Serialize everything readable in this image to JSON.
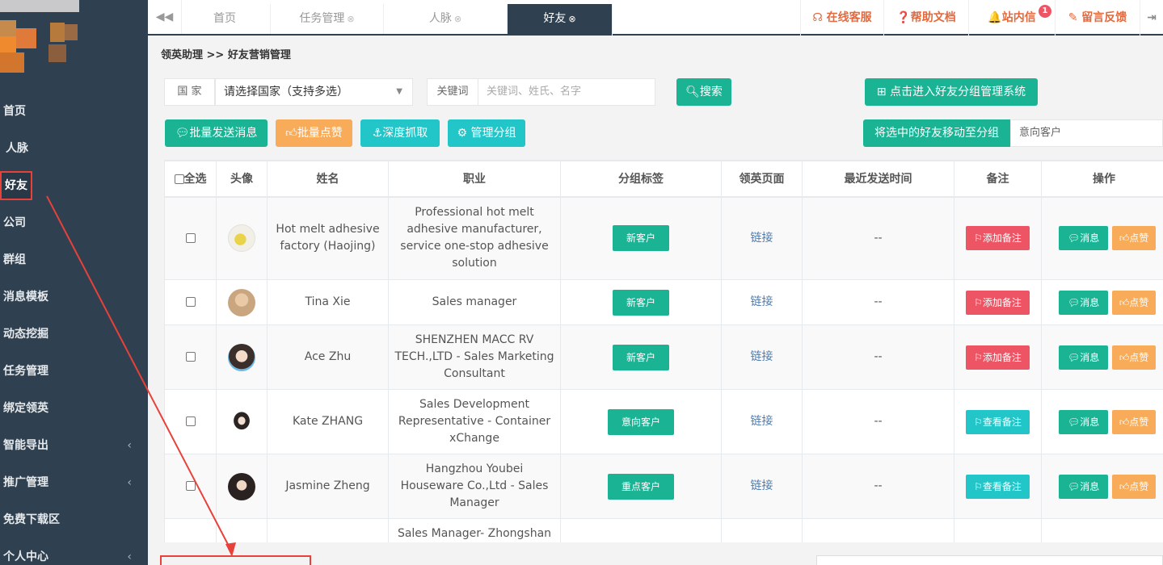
{
  "sidebar": {
    "items": [
      {
        "label": "首页",
        "arrow": ""
      },
      {
        "label": "人脉",
        "arrow": ""
      },
      {
        "label": "好友",
        "arrow": ""
      },
      {
        "label": "公司",
        "arrow": ""
      },
      {
        "label": "群组",
        "arrow": ""
      },
      {
        "label": "消息模板",
        "arrow": ""
      },
      {
        "label": "动态挖掘",
        "arrow": ""
      },
      {
        "label": "任务管理",
        "arrow": ""
      },
      {
        "label": "绑定领英",
        "arrow": ""
      },
      {
        "label": "智能导出",
        "arrow": "‹"
      },
      {
        "label": "推广管理",
        "arrow": "‹"
      },
      {
        "label": "免费下载区",
        "arrow": ""
      },
      {
        "label": "个人中心",
        "arrow": "‹"
      }
    ],
    "active_index": 2
  },
  "topbar": {
    "back_icon": "◀◀",
    "tabs": [
      {
        "label": "首页",
        "close": ""
      },
      {
        "label": "任务管理",
        "close": "⊗"
      },
      {
        "label": "人脉",
        "close": "⊗"
      },
      {
        "label": "好友",
        "close": "⊗"
      }
    ],
    "links": {
      "service": "在线客服",
      "help": "帮助文档",
      "inbox": "站内信",
      "inbox_badge": "1",
      "feedback": "留言反馈"
    }
  },
  "breadcrumb": "领英助理  >>  好友营销管理",
  "filters": {
    "country_label": "国  家",
    "country_value": "请选择国家（支持多选）",
    "keyword_label": "关键词",
    "keyword_placeholder": "关键词、姓氏、名字",
    "search_button": "搜索",
    "group_system_button": "点击进入好友分组管理系统"
  },
  "actions": {
    "batch_message": "批量发送消息",
    "batch_like": "批量点赞",
    "deep_fetch": "深度抓取",
    "manage_groups": "管理分组",
    "move_to_group": "将选中的好友移动至分组",
    "target_group": "意向客户"
  },
  "table": {
    "headers": {
      "select_all": "全选",
      "avatar": "头像",
      "name": "姓名",
      "job": "职业",
      "group_tag": "分组标签",
      "linkedin_page": "领英页面",
      "last_sent": "最近发送时间",
      "remark": "备注",
      "ops": "操作"
    },
    "rows": [
      {
        "name": "Hot melt adhesive factory (Haojing)",
        "job": "Professional hot melt adhesive manufacturer, service one-stop adhesive solution",
        "tag": "新客户",
        "link": "链接",
        "last_sent": "--",
        "remark": "添加备注",
        "msg": "消息",
        "like": "点赞"
      },
      {
        "name": "Tina Xie",
        "job": "Sales manager",
        "tag": "新客户",
        "link": "链接",
        "last_sent": "--",
        "remark": "添加备注",
        "msg": "消息",
        "like": "点赞"
      },
      {
        "name": "Ace Zhu",
        "job": "SHENZHEN MACC RV TECH.,LTD - Sales Marketing Consultant",
        "tag": "新客户",
        "link": "链接",
        "last_sent": "--",
        "remark": "添加备注",
        "msg": "消息",
        "like": "点赞"
      },
      {
        "name": "Kate ZHANG",
        "job": "Sales Development Representative - Container xChange",
        "tag": "意向客户",
        "link": "链接",
        "last_sent": "--",
        "remark": "查看备注",
        "msg": "消息",
        "like": "点赞"
      },
      {
        "name": "Jasmine Zheng",
        "job": "Hangzhou Youbei Houseware Co.,Ltd - Sales Manager",
        "tag": "重点客户",
        "link": "链接",
        "last_sent": "--",
        "remark": "查看备注",
        "msg": "消息",
        "like": "点赞"
      },
      {
        "name": "",
        "job": "Sales Manager- Zhongshan",
        "tag": "",
        "link": "",
        "last_sent": "",
        "remark": "",
        "msg": "",
        "like": ""
      }
    ]
  },
  "colors": {
    "sidebar_bg": "#2f4050",
    "primary_green": "#1ab394",
    "orange": "#f8ac59",
    "teal": "#23c6c8",
    "red": "#ed5565",
    "top_link": "#e4693c",
    "annotation_red": "#e8413a"
  }
}
